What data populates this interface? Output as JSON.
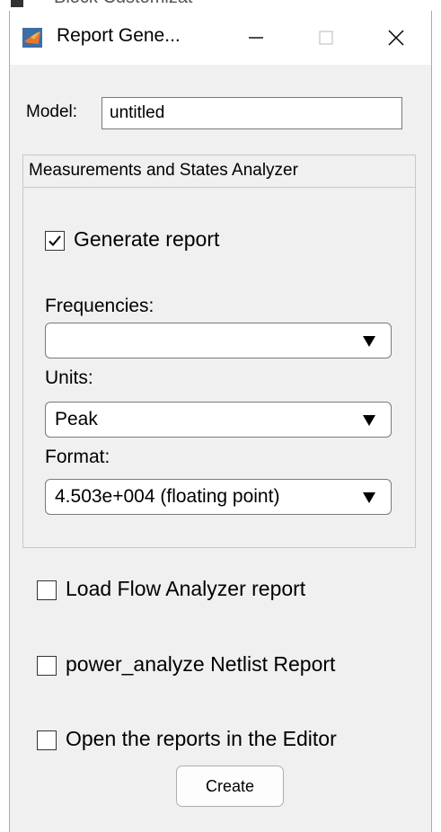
{
  "window": {
    "title": "Report Gene...",
    "icon": "matlab-icon",
    "controls": [
      "minimize-icon",
      "maximize-icon",
      "close-icon"
    ]
  },
  "background": {
    "partial_text": "Block Customizat"
  },
  "model": {
    "label": "Model:",
    "value": "untitled"
  },
  "panel": {
    "title": "Measurements and States Analyzer",
    "generate_report": {
      "label": "Generate report",
      "checked": true
    },
    "frequencies": {
      "label": "Frequencies:",
      "selected": ""
    },
    "units": {
      "label": "Units:",
      "selected": "Peak"
    },
    "format": {
      "label": "Format:",
      "selected": "4.503e+004 (floating point)"
    }
  },
  "options": {
    "load_flow": {
      "label": "Load Flow Analyzer report",
      "checked": false
    },
    "netlist": {
      "label": "power_analyze Netlist Report",
      "checked": false
    },
    "open_editor": {
      "label": "Open the reports in the Editor",
      "checked": false
    }
  },
  "create_label": "Create",
  "colors": {
    "window_bg": "#f0f0f0",
    "titlebar_bg": "#ffffff",
    "border": "#7a7a7a"
  }
}
